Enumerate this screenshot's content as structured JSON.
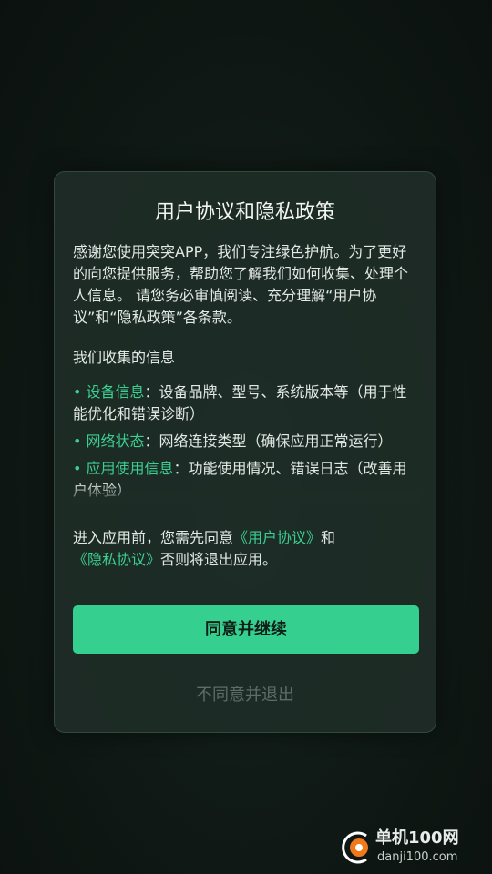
{
  "dialog": {
    "title": "用户协议和隐私政策",
    "intro": "感谢您使用突突APP，我们专注绿色护航。为了更好的向您提供服务，帮助您了解我们如何收集、处理个人信息。 请您务必审慎阅读、充分理解“用户协议”和“隐私政策”各条款。",
    "section_title": "我们收集的信息",
    "items": [
      {
        "bullet": "•",
        "label": "设备信息",
        "text": "：设备品牌、型号、系统版本等（用于性能优化和错误诊断）"
      },
      {
        "bullet": "•",
        "label": "网络状态",
        "text": "：网络连接类型（确保应用正常运行）"
      },
      {
        "bullet": "•",
        "label": "应用使用信息",
        "text": "：功能使用情况、错误日志（改善用户体验）"
      }
    ],
    "consent": {
      "prefix": "进入应用前，您需先同意",
      "link1": "《用户协议》",
      "middle": "和",
      "link2": "《隐私协议》",
      "suffix": "否则将退出应用。"
    },
    "agree_label": "同意并继续",
    "disagree_label": "不同意并退出"
  },
  "watermark": {
    "title": "单机100网",
    "url": "danji100.com"
  },
  "colors": {
    "accent": "#35d08f",
    "link": "#3ccf91",
    "dialog_bg": "#1e2c27",
    "disabled_text": "#5f6c67"
  }
}
